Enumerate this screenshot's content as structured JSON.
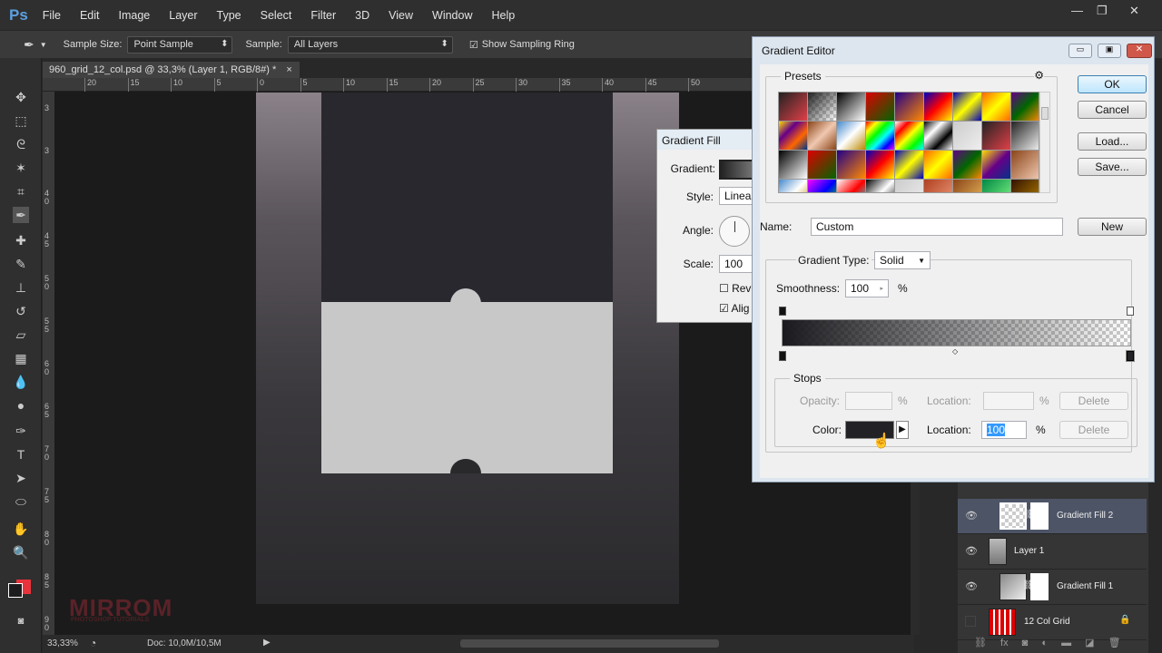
{
  "app": {
    "logo": "Ps",
    "menu": [
      "File",
      "Edit",
      "Image",
      "Layer",
      "Type",
      "Select",
      "Filter",
      "3D",
      "View",
      "Window",
      "Help"
    ]
  },
  "options": {
    "sample_size_label": "Sample Size:",
    "sample_size": "Point Sample",
    "sample_label": "Sample:",
    "sample": "All Layers",
    "show_ring": "Show Sampling Ring"
  },
  "document": {
    "tab": "960_grid_12_col.psd @ 33,3% (Layer 1, RGB/8#) *",
    "close": "×",
    "ruler_top": [
      "20",
      "15",
      "10",
      "5",
      "0",
      "5",
      "10",
      "15",
      "20",
      "25",
      "30",
      "35",
      "40",
      "45",
      "50"
    ],
    "ruler_left": [
      "3",
      "3",
      "4 0",
      "4 5",
      "5 0",
      "5 5",
      "6 0",
      "6 5",
      "7 0",
      "7 5",
      "8 0",
      "8 5",
      "9 0"
    ],
    "watermark": "MIRROM",
    "watermark_sub": "PHOTOSHOP TUTORIALS"
  },
  "status": {
    "zoom": "33,33%",
    "doc": "Doc: 10,0M/10,5M"
  },
  "gradient_fill": {
    "title": "Gradient Fill",
    "gradient_label": "Gradient:",
    "style_label": "Style:",
    "style": "Linea",
    "angle_label": "Angle:",
    "scale_label": "Scale:",
    "scale": "100",
    "reverse": "Rev",
    "align": "Alig"
  },
  "gradient_editor": {
    "title": "Gradient Editor",
    "presets_label": "Presets",
    "ok": "OK",
    "cancel": "Cancel",
    "load": "Load...",
    "save": "Save...",
    "name_label": "Name:",
    "name": "Custom",
    "new": "New",
    "type_label": "Gradient Type:",
    "type": "Solid",
    "smoothness_label": "Smoothness:",
    "smoothness": "100",
    "pct": "%",
    "stops_label": "Stops",
    "opacity_label": "Opacity:",
    "location_label": "Location:",
    "delete": "Delete",
    "color_label": "Color:",
    "color_location": "100",
    "stop_color": "#222226",
    "presets": [
      [
        "#222",
        "#e04048"
      ],
      [
        "#222",
        "transparent"
      ],
      [
        "#000",
        "#fff"
      ],
      [
        "#d00",
        "#060"
      ],
      [
        "#208",
        "#f80"
      ],
      [
        "#00b",
        "#f00",
        "#ff0"
      ],
      [
        "#00b",
        "#ff0",
        "#00b"
      ],
      [
        "#f60",
        "#ff0",
        "#f60"
      ],
      [
        "#608",
        "#060",
        "#f80"
      ],
      [
        "#fd0",
        "#608",
        "#f60",
        "#038"
      ],
      [
        "#8a4418",
        "#f0c8b0",
        "#8a4418"
      ],
      [
        "#48c",
        "#fff",
        "#b80"
      ],
      [
        "#f00",
        "#ff0",
        "#0f0",
        "#0ff",
        "#00f",
        "#f0f"
      ],
      [
        "#fff",
        "#f00",
        "#ff0",
        "#0f0",
        "#0ff"
      ],
      [
        "#000",
        "#fff",
        "#000",
        "#fff"
      ],
      [
        "#ccc",
        "#eee"
      ],
      [
        "#222",
        "#e04048"
      ],
      [
        "#222",
        "#eee"
      ],
      [
        "#000",
        "#fff"
      ],
      [
        "#d00",
        "#060"
      ],
      [
        "#208",
        "#f80"
      ],
      [
        "#00b",
        "#f00",
        "#ff0"
      ],
      [
        "#00b",
        "#ff0",
        "#00b"
      ],
      [
        "#f60",
        "#ff0",
        "#f60"
      ],
      [
        "#608",
        "#060",
        "#f80"
      ],
      [
        "#fd0",
        "#608",
        "#038"
      ],
      [
        "#8a4418",
        "#f0c8b0"
      ],
      [
        "#48c",
        "#fff",
        "#b80"
      ],
      [
        "#f0f",
        "#00f",
        "#0f0"
      ],
      [
        "#fff",
        "#f00",
        "#0ff"
      ],
      [
        "#000",
        "#fff",
        "#000"
      ],
      [
        "#ccc",
        "#eee"
      ],
      [
        "#b04020",
        "#f0a080"
      ],
      [
        "#8a4418",
        "#f0c060"
      ],
      [
        "#084",
        "#8f8"
      ],
      [
        "#310",
        "#b80"
      ]
    ]
  },
  "layers": [
    {
      "name": "Gradient Fill 2",
      "visible": true,
      "selected": true
    },
    {
      "name": "Layer 1",
      "visible": true
    },
    {
      "name": "Gradient Fill 1",
      "visible": true
    },
    {
      "name": "12 Col Grid",
      "visible": false,
      "locked": true
    }
  ],
  "colors": {
    "foreground": "#1c1c1e",
    "background": "#e8333c"
  }
}
